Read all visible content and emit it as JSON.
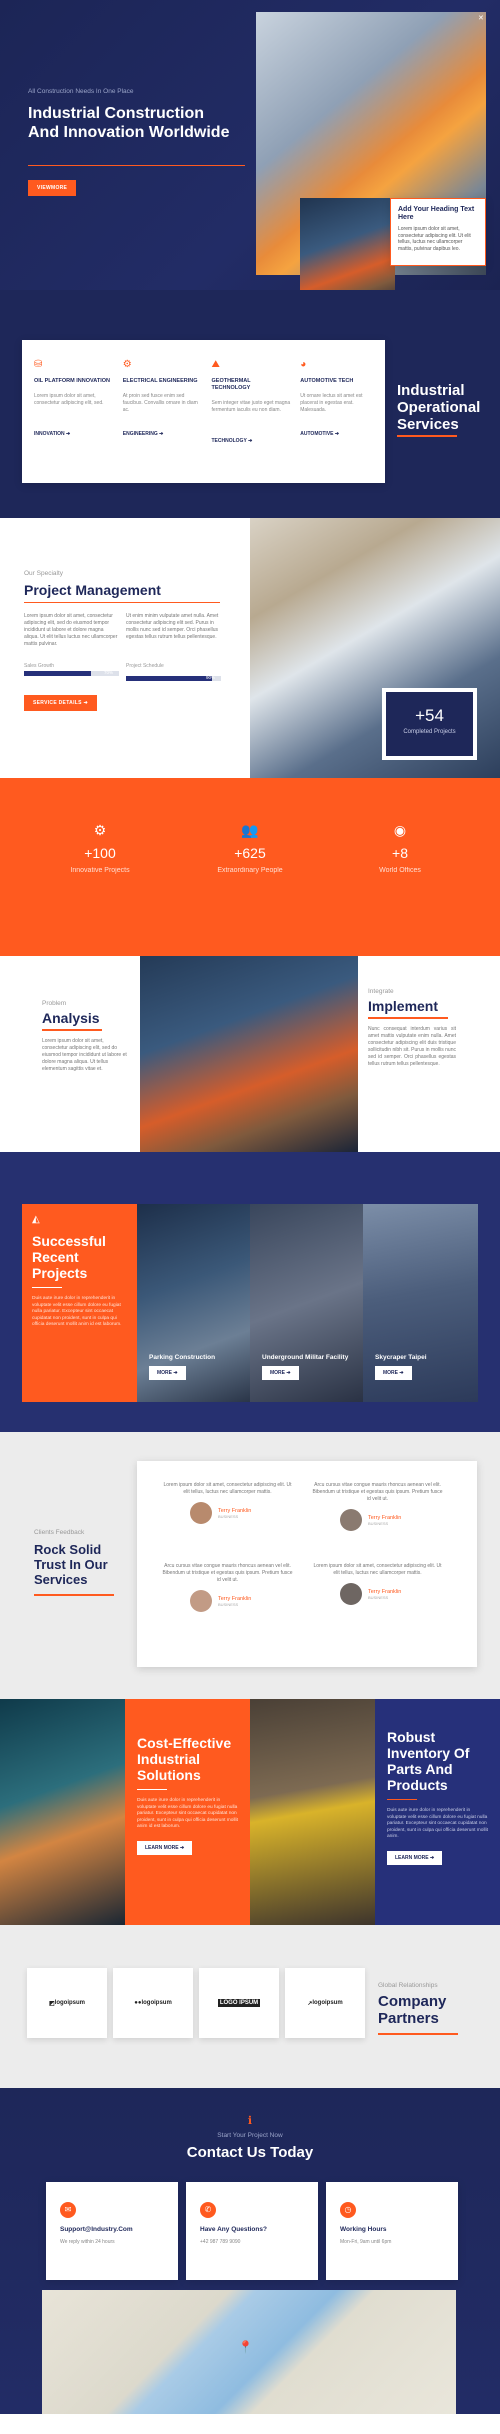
{
  "hero": {
    "kicker": "All Construction Needs In One Place",
    "title": "Industrial Construction And Innovation Worldwide",
    "button": "VIEWMORE",
    "callout_title": "Add Your Heading Text Here",
    "callout_text": "Lorem ipsum dolor sit amet, consectetur adipiscing elit. Ut elit tellus, luctus nec ullamcorper mattis, pulvinar dapibus leo."
  },
  "services": {
    "heading": "Industrial Operational Services",
    "items": [
      {
        "title": "OIL PLATFORM INNOVATION",
        "text": "Lorem ipsum dolor sit amet, consectetur adipiscing elit, sed.",
        "link": "INNOVATION"
      },
      {
        "title": "ELECTRICAL ENGINEERING",
        "text": "At proin sed fusce enim sed faucibus. Convallis ornare in diam ac.",
        "link": "ENGINEERING"
      },
      {
        "title": "GEOTHERMAL TECHNOLOGY",
        "text": "Sem integer vitae justo eget magna fermentum iaculis eu non diam.",
        "link": "TECHNOLOGY"
      },
      {
        "title": "AUTOMOTIVE TECH",
        "text": "Ut ornare lectus sit amet est placerat in egestas erat. Malesuada.",
        "link": "AUTOMOTIVE"
      }
    ]
  },
  "project": {
    "kicker": "Our Specialty",
    "title": "Project Management",
    "text1": "Lorem ipsum dolor sit amet, consectetur adipiscing elit, sed do eiusmod tempor incididunt ut labore et dolore magna aliqua. Ut elit tellus luctus nec ullamcorper mattis pulvinar.",
    "text2": "Ut enim minim vulputate amet nulla. Amet consectetur adipiscing elit sed. Purus in mollis nunc sed id semper. Orci phasellus egestas tellus rutrum tellus pellentesque.",
    "bar1_label": "Sales Growth",
    "bar1_value": "70%",
    "bar1": 0.7,
    "bar2_label": "Project Schedule",
    "bar2_value": "90%",
    "bar2": 0.9,
    "button": "SERVICE DETAILS",
    "stat_value": "+54",
    "stat_label": "Completed Projects"
  },
  "stats": [
    {
      "value": "+100",
      "label": "Innovative Projects"
    },
    {
      "value": "+625",
      "label": "Extraordinary People"
    },
    {
      "value": "+8",
      "label": "World Offices"
    }
  ],
  "analysis": {
    "kicker": "Problem",
    "title": "Analysis",
    "text": "Lorem ipsum dolor sit amet, consectetur adipiscing elit, sed do eiusmod tempor incididunt ut labore et dolore magna aliqua. Ut tellus elementum sagittis vitae et.",
    "kicker2": "Integrate",
    "title2": "Implement",
    "text2": "Nunc consequat interdum varius sit amet mattis vulputate enim nulla. Amet consectetur adipiscing elit duis tristique sollicitudin nibh sit. Purus in mollis nunc sed id semper. Orci phasellus egestas tellus rutrum tellus pellentesque."
  },
  "projects": {
    "title": "Successful Recent Projects",
    "text": "Duis aute irure dolor in reprehenderit in voluptate velit esse cillum dolore eu fugiat nulla pariatur. Excepteur sint occaecat cupidatat non proident, sunt in culpa qui officia deserunt mollit anim id est laborum.",
    "items": [
      {
        "name": "Parking Construction",
        "btn": "MORE"
      },
      {
        "name": "Underground Militar Facility",
        "btn": "MORE"
      },
      {
        "name": "Skycraper Taipei",
        "btn": "MORE"
      }
    ]
  },
  "testimonials": {
    "kicker": "Clients Feedback",
    "title": "Rock Solid Trust In Our Services",
    "items": [
      {
        "text": "Lorem ipsum dolor sit amet, consectetur adipiscing elit. Ut elit tellus, luctus nec ullamcorper mattis.",
        "name": "Terry Franklin",
        "role": "BUSINESS"
      },
      {
        "text": "Arcu cursus vitae congue mauris rhoncus aenean vel elit. Bibendum ut tristique et egestas quis ipsum. Pretium fusce id velit ut.",
        "name": "Terry Franklin",
        "role": "BUSINESS"
      },
      {
        "text": "Arcu cursus vitae congue mauris rhoncus aenean vel elit. Bibendum ut tristique et egestas quis ipsum. Pretium fusce id velit ut.",
        "name": "Terry Franklin",
        "role": "BUSINESS"
      },
      {
        "text": "Lorem ipsum dolor sit amet, consectetur adipiscing elit. Ut elit tellus, luctus nec ullamcorper mattis.",
        "name": "Terry Franklin",
        "role": "BUSINESS"
      }
    ]
  },
  "solutions": {
    "title": "Cost-Effective Industrial Solutions",
    "text": "Duis aute irure dolor in reprehenderit in voluptate velit esse cillum dolore eu fugiat nulla pariatur. Excepteur sint occaecat cupidatat non proident, sunt in culpa qui officia deserunt mollit anim id est laborum.",
    "button": "LEARN MORE",
    "title2": "Robust Inventory Of Parts And Products",
    "text2": "Duis aute irure dolor in reprehenderit in voluptate velit esse cillum dolore eu fugiat nulla pariatur. Excepteur sint occaecat cupidatat non proident, sunt in culpa qui officia deserunt mollit anim.",
    "button2": "LEARN MORE"
  },
  "partners": {
    "kicker": "Global Relationships",
    "title": "Company Partners",
    "logos": [
      "logoipsum",
      "logoipsum",
      "LOGO IPSUM",
      "logoipsum"
    ]
  },
  "contact": {
    "kicker": "Start Your Project Now",
    "title": "Contact Us Today",
    "cards": [
      {
        "title": "Support@Industry.Com",
        "text": "We reply within 24 hours"
      },
      {
        "title": "Have Any Questions?",
        "text": "+42 987 789 9090"
      },
      {
        "title": "Working Hours",
        "text": "Mon-Fri, 9am until 6pm"
      }
    ]
  },
  "colors": {
    "navy": "#1e2759",
    "orange": "#ff5a1f"
  }
}
